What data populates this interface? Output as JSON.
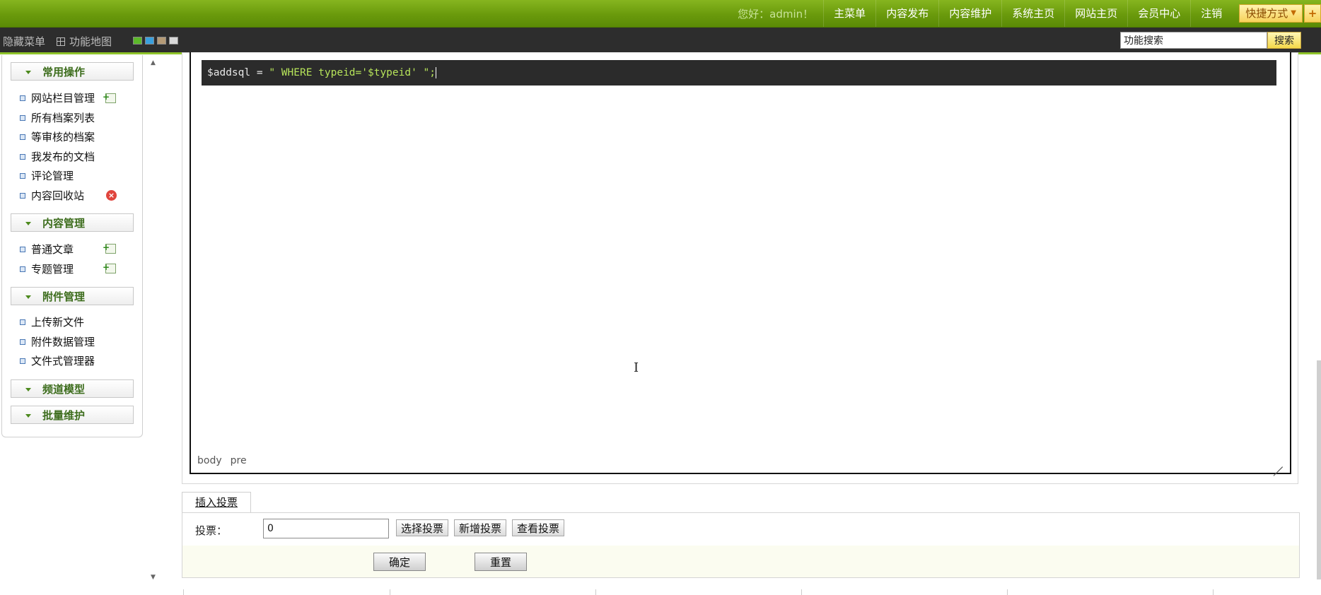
{
  "topbar": {
    "greeting": "您好：admin！",
    "nav": [
      "主菜单",
      "内容发布",
      "内容维护",
      "系统主页",
      "网站主页",
      "会员中心",
      "注销"
    ],
    "quick": "快捷方式",
    "plus": "+"
  },
  "subbar": {
    "hide_menu": "隐藏菜单",
    "sitemap": "功能地图",
    "swatch_colors": [
      "#5cb82a",
      "#3aa0de",
      "#b49a76",
      "#d8d8d8"
    ],
    "search_value": "功能搜索",
    "search_button": "搜索"
  },
  "sidebar": {
    "groups": [
      {
        "title": "常用操作",
        "items": [
          "网站栏目管理",
          "所有档案列表",
          "等审核的档案",
          "我发布的文档",
          "评论管理",
          "内容回收站"
        ]
      },
      {
        "title": "内容管理",
        "items": [
          "普通文章",
          "专题管理"
        ]
      },
      {
        "title": "附件管理",
        "items": [
          "上传新文件",
          "附件数据管理",
          "文件式管理器"
        ]
      },
      {
        "title": "频道模型",
        "items": []
      },
      {
        "title": "批量维护",
        "items": []
      }
    ]
  },
  "editor": {
    "code_var": "$addsql = ",
    "code_str": "\" WHERE typeid='$typeid' \";",
    "path": [
      "body",
      "pre"
    ]
  },
  "vote": {
    "tab": "插入投票",
    "label": "投票：",
    "value": "0",
    "buttons": [
      "选择投票",
      "新增投票",
      "查看投票"
    ]
  },
  "form": {
    "submit": "确定",
    "reset": "重置"
  }
}
